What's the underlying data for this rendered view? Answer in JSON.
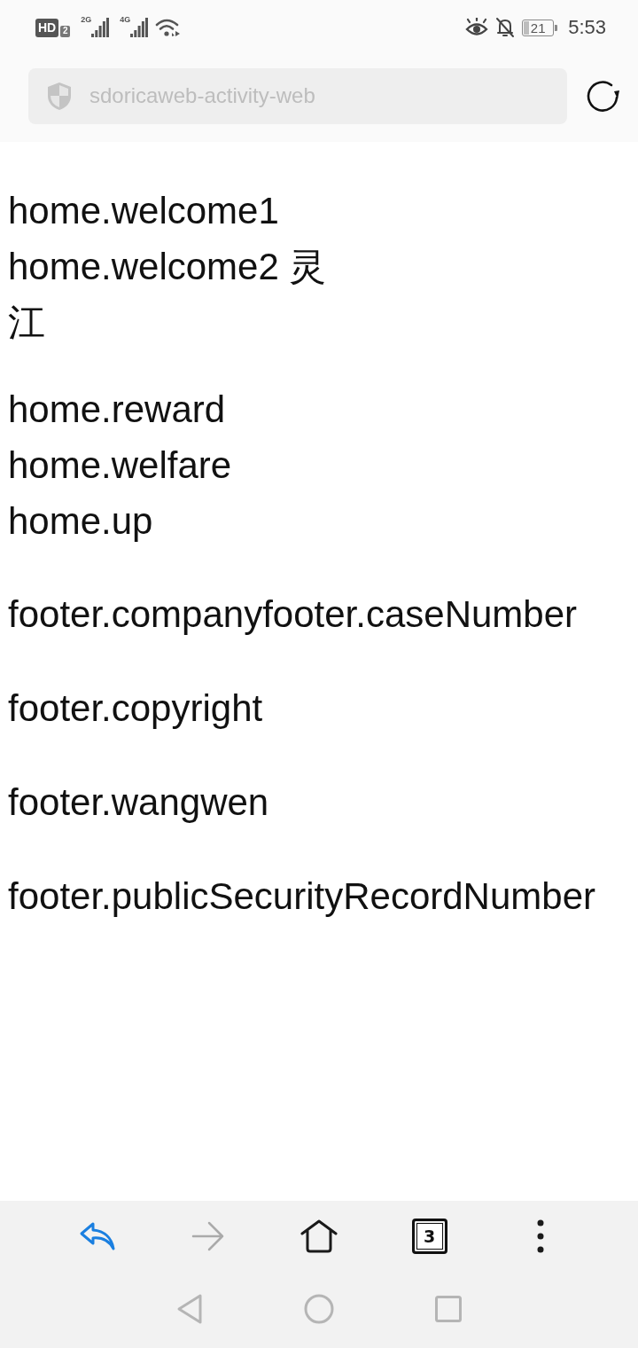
{
  "status_bar": {
    "network_badge": "HD",
    "sim_badge": "2",
    "signals": [
      {
        "label": "2G"
      },
      {
        "label": "4G"
      }
    ],
    "battery": "21",
    "time": "5:53"
  },
  "address_bar": {
    "text": "sdoricaweb-activity-web"
  },
  "content": {
    "sections": [
      {
        "lines": [
          "home.welcome1",
          "home.welcome2 灵江"
        ]
      },
      {
        "lines": [
          "home.reward",
          "home.welfare",
          "home.up"
        ]
      }
    ],
    "footer": [
      "footer.companyfooter.caseNumber",
      "footer.copyright",
      "footer.wangwen",
      "footer.publicSecurityRecordNumber"
    ]
  },
  "toolbar": [
    {
      "kind": "back",
      "disabled": false
    },
    {
      "kind": "forward",
      "disabled": true
    },
    {
      "kind": "home",
      "disabled": false
    },
    {
      "kind": "tabs",
      "label": "3",
      "disabled": false
    },
    {
      "kind": "menu",
      "disabled": false
    }
  ]
}
